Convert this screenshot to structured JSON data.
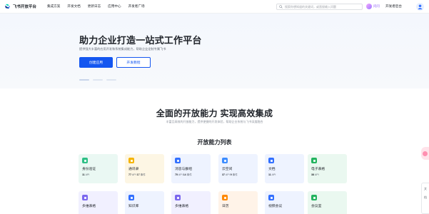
{
  "nav": {
    "logo_text": "飞书开放平台",
    "menu": [
      "集成方案",
      "开发文档",
      "更新日志",
      "应用中心",
      "开发者广场"
    ],
    "search_placeholder": "搜索你想知道的关键词，或直接输入问题",
    "ai_label": "问问",
    "console_label": "开发者后台",
    "accent": "#1456f0"
  },
  "hero": {
    "title": "助力企业打造一站式工作平台",
    "subtitle": "提供强大丰富的应用开发和系统集成能力，帮助企业定制专属飞书",
    "primary_btn": "创建应用",
    "secondary_btn": "开发教程"
  },
  "section": {
    "title": "全面的开放能力 实现高效集成",
    "subtitle": "丰富且高效的开放能力，提供便捷的开发体验，帮助企业系统与飞书深度融合",
    "list_title": "开放能力列表"
  },
  "cards": [
    {
      "name": "身份验证",
      "api": "11",
      "api_unit": "API",
      "events": "",
      "events_unit": "",
      "bg": "#eaf8f3",
      "icon_bg": "#2dbf85",
      "icon": "id-card-icon"
    },
    {
      "name": "通讯录",
      "api": "77",
      "api_unit": "API",
      "events": "17",
      "events_unit": "事件",
      "bg": "#fdf6e4",
      "icon_bg": "#f5b400",
      "icon": "contacts-icon"
    },
    {
      "name": "消息与群组",
      "api": "75",
      "api_unit": "API",
      "events": "14",
      "events_unit": "事件",
      "bg": "#eef3ff",
      "icon_bg": "#3370ff",
      "icon": "message-icon"
    },
    {
      "name": "云空间",
      "api": "37",
      "api_unit": "API",
      "events": "9",
      "events_unit": "事件",
      "bg": "#eef3ff",
      "icon_bg": "#3c8cff",
      "icon": "cloud-icon"
    },
    {
      "name": "文档",
      "api": "11",
      "api_unit": "API",
      "events": "",
      "events_unit": "",
      "bg": "#eef3ff",
      "icon_bg": "#3370ff",
      "icon": "doc-icon"
    },
    {
      "name": "电子表格",
      "api": "38",
      "api_unit": "API",
      "events": "",
      "events_unit": "",
      "bg": "#eaf8f0",
      "icon_bg": "#22b35e",
      "icon": "sheet-icon"
    },
    {
      "name": "多维表格",
      "api": "",
      "api_unit": "",
      "events": "",
      "events_unit": "",
      "bg": "#f1f0ff",
      "icon_bg": "#7b67ee",
      "icon": "base-icon"
    },
    {
      "name": "知识库",
      "api": "",
      "api_unit": "",
      "events": "",
      "events_unit": "",
      "bg": "#eef3ff",
      "icon_bg": "#3370ff",
      "icon": "wiki-icon"
    },
    {
      "name": "多维表格",
      "api": "",
      "api_unit": "",
      "events": "",
      "events_unit": "",
      "bg": "#f1f0ff",
      "icon_bg": "#7b67ee",
      "icon": "base-icon"
    },
    {
      "name": "日历",
      "api": "",
      "api_unit": "",
      "events": "",
      "events_unit": "",
      "bg": "#fff3e8",
      "icon_bg": "#ff8800",
      "icon": "calendar-icon"
    },
    {
      "name": "视频会议",
      "api": "",
      "api_unit": "",
      "events": "",
      "events_unit": "",
      "bg": "#eef3ff",
      "icon_bg": "#3370ff",
      "icon": "video-icon"
    },
    {
      "name": "会议室",
      "api": "",
      "api_unit": "",
      "events": "",
      "events_unit": "",
      "bg": "#eaf8f0",
      "icon_bg": "#22b35e",
      "icon": "room-icon"
    }
  ],
  "side_tool": [
    "文",
    "档"
  ]
}
